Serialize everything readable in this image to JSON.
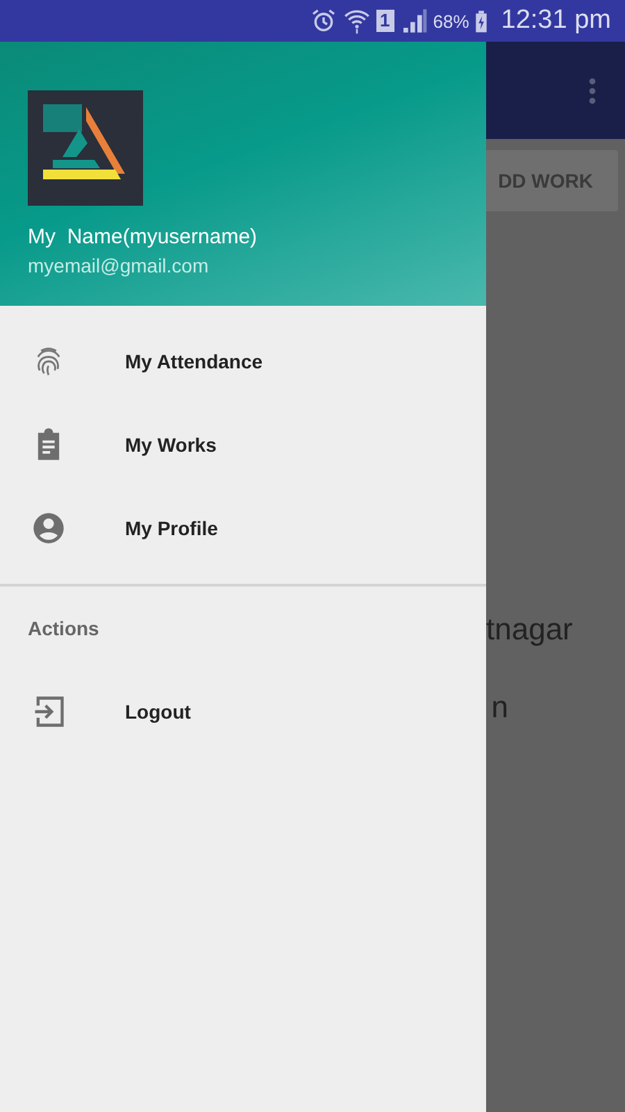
{
  "status_bar": {
    "sim": "1",
    "battery": "68%",
    "time": "12:31 pm"
  },
  "background": {
    "button": "DD WORK",
    "lines": [
      "tnagar",
      "n"
    ]
  },
  "drawer": {
    "header": {
      "name": "My  Name(myusername)",
      "email": "myemail@gmail.com"
    },
    "items": [
      {
        "label": "My Attendance",
        "kind": "fingerprint"
      },
      {
        "label": "My Works",
        "kind": "clipboard"
      },
      {
        "label": "My Profile",
        "kind": "person"
      }
    ],
    "section": {
      "title": "Actions",
      "items": [
        {
          "label": "Logout",
          "kind": "logout"
        }
      ]
    }
  }
}
